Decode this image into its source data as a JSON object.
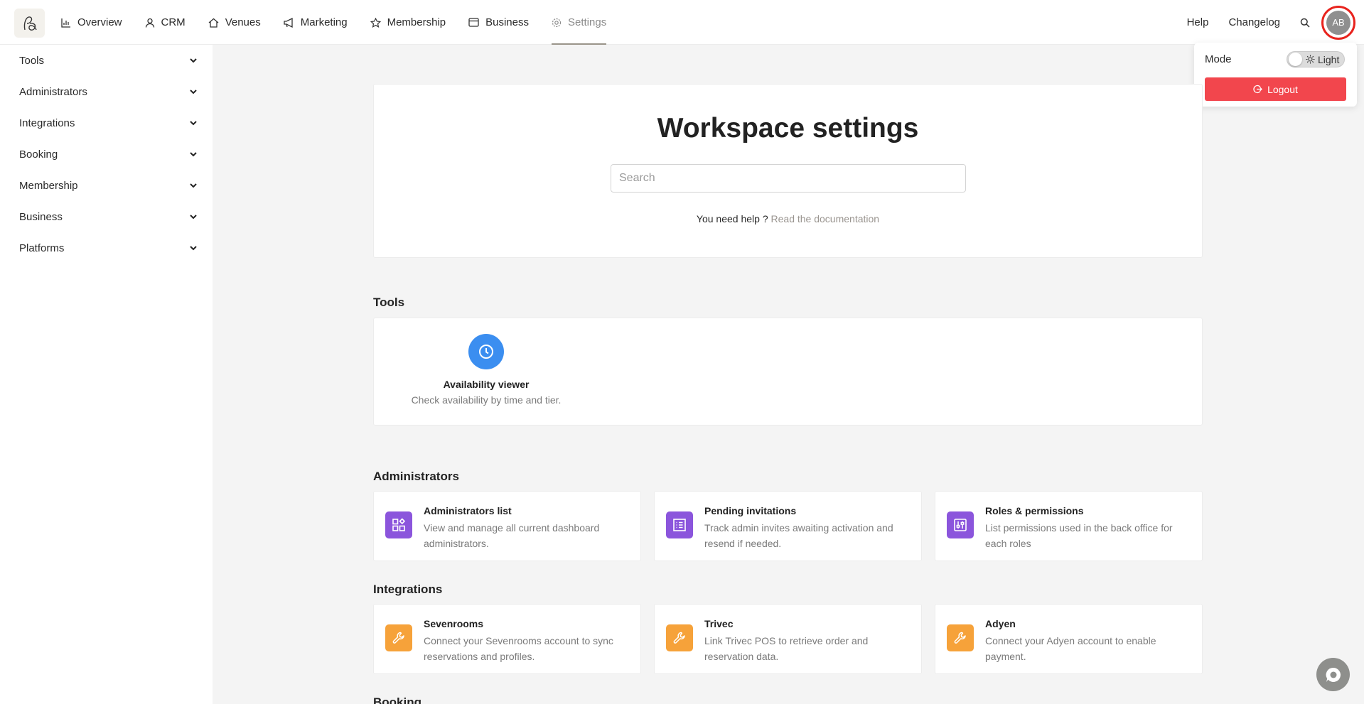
{
  "colors": {
    "accent_purple": "#8b55dc",
    "accent_orange": "#f6a23a",
    "accent_blue": "#3b8ef0",
    "danger": "#f2464d"
  },
  "nav": {
    "items": [
      {
        "label": "Overview",
        "icon": "chart-icon"
      },
      {
        "label": "CRM",
        "icon": "user-icon"
      },
      {
        "label": "Venues",
        "icon": "home-icon"
      },
      {
        "label": "Marketing",
        "icon": "megaphone-icon"
      },
      {
        "label": "Membership",
        "icon": "star-icon"
      },
      {
        "label": "Business",
        "icon": "wallet-icon"
      },
      {
        "label": "Settings",
        "icon": "gear-icon"
      }
    ],
    "help": "Help",
    "changelog": "Changelog",
    "avatar_initials": "AB"
  },
  "user_menu": {
    "mode_label": "Mode",
    "mode_value": "Light",
    "logout": "Logout"
  },
  "sidebar": {
    "items": [
      "Tools",
      "Administrators",
      "Integrations",
      "Booking",
      "Membership",
      "Business",
      "Platforms"
    ]
  },
  "hero": {
    "title": "Workspace settings",
    "search_placeholder": "Search",
    "help_text": "You need help ?",
    "help_link": "Read the documentation"
  },
  "sections": {
    "tools": {
      "title": "Tools",
      "items": [
        {
          "title": "Availability viewer",
          "desc": "Check availability by time and tier.",
          "icon": "clock-icon"
        }
      ]
    },
    "administrators": {
      "title": "Administrators",
      "items": [
        {
          "title": "Administrators list",
          "desc": "View and manage all current dashboard administrators.",
          "icon": "grid-icon"
        },
        {
          "title": "Pending invitations",
          "desc": "Track admin invites awaiting activation and resend if needed.",
          "icon": "list-icon"
        },
        {
          "title": "Roles & permissions",
          "desc": "List permissions used in the back office for each roles",
          "icon": "sliders-icon"
        }
      ]
    },
    "integrations": {
      "title": "Integrations",
      "items": [
        {
          "title": "Sevenrooms",
          "desc": "Connect your Sevenrooms account to sync reservations and profiles.",
          "icon": "wrench-icon"
        },
        {
          "title": "Trivec",
          "desc": "Link Trivec POS to retrieve order and reservation data.",
          "icon": "wrench-icon"
        },
        {
          "title": "Adyen",
          "desc": "Connect your Adyen account to enable payment.",
          "icon": "wrench-icon"
        }
      ]
    },
    "booking": {
      "title": "Booking"
    }
  }
}
